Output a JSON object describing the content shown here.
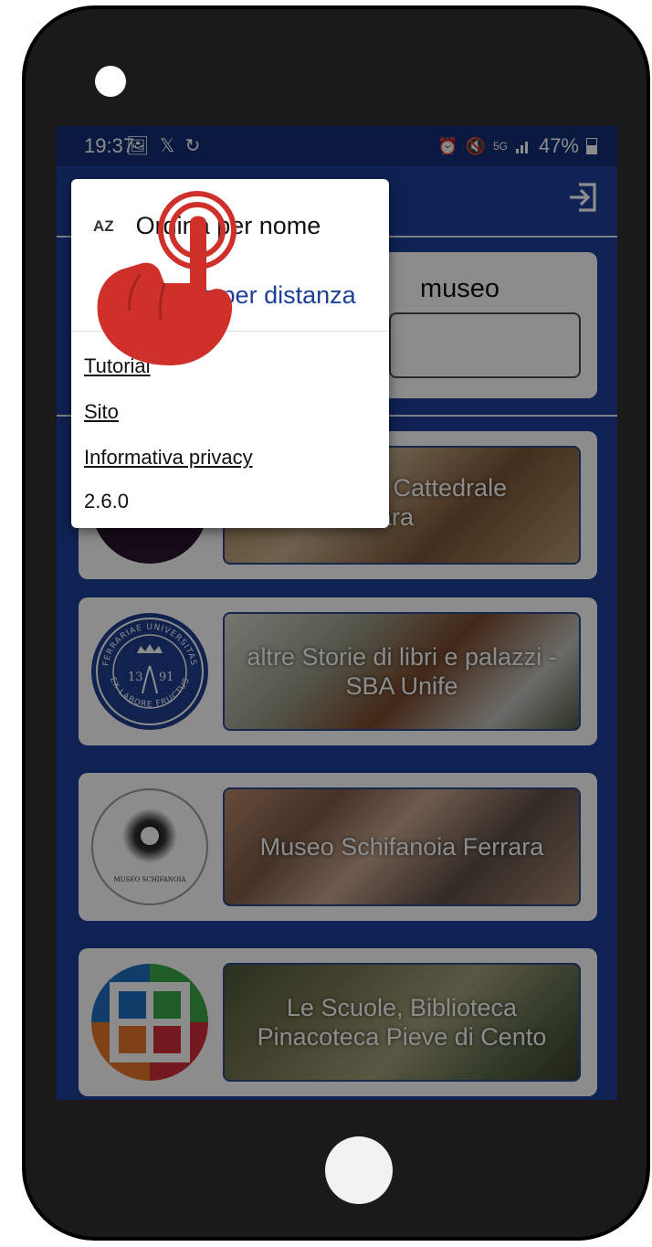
{
  "status_bar": {
    "time": "19:37",
    "battery": "47%",
    "left_icons": "🖼 𝕏 ↻",
    "network": "5G"
  },
  "header": {
    "logout_icon": "logout-icon"
  },
  "search": {
    "label": "museo"
  },
  "sort_menu": {
    "az_icon": "AZ",
    "sort_by_name": "Ordina per nome",
    "sort_by_distance": "Ordina per distanza",
    "tutorial": "Tutorial",
    "site": "Sito",
    "privacy": "Informativa privacy",
    "version": "2.6.0"
  },
  "museums": [
    {
      "name": "Museo della Cattedrale di Ferrara",
      "visible_text": "lla Cattedrale\nrrara"
    },
    {
      "name": "altre Storie di libri e palazzi - SBA Unife",
      "logo_top": "FERRARIAE UNIVERSITAS",
      "logo_bottom": "EX LABORE FRUCTUS",
      "logo_left": "13",
      "logo_right": "91"
    },
    {
      "name": "Museo Schifanoia Ferrara",
      "logo_text": "MUSEO SCHIFANOIA"
    },
    {
      "name": "Le Scuole, Biblioteca Pinacoteca Pieve di Cento"
    }
  ],
  "colors": {
    "primary": "#1c3f98",
    "status_bar": "#122e74",
    "accent_red": "#d0302a",
    "link_blue": "#1c3f98"
  }
}
